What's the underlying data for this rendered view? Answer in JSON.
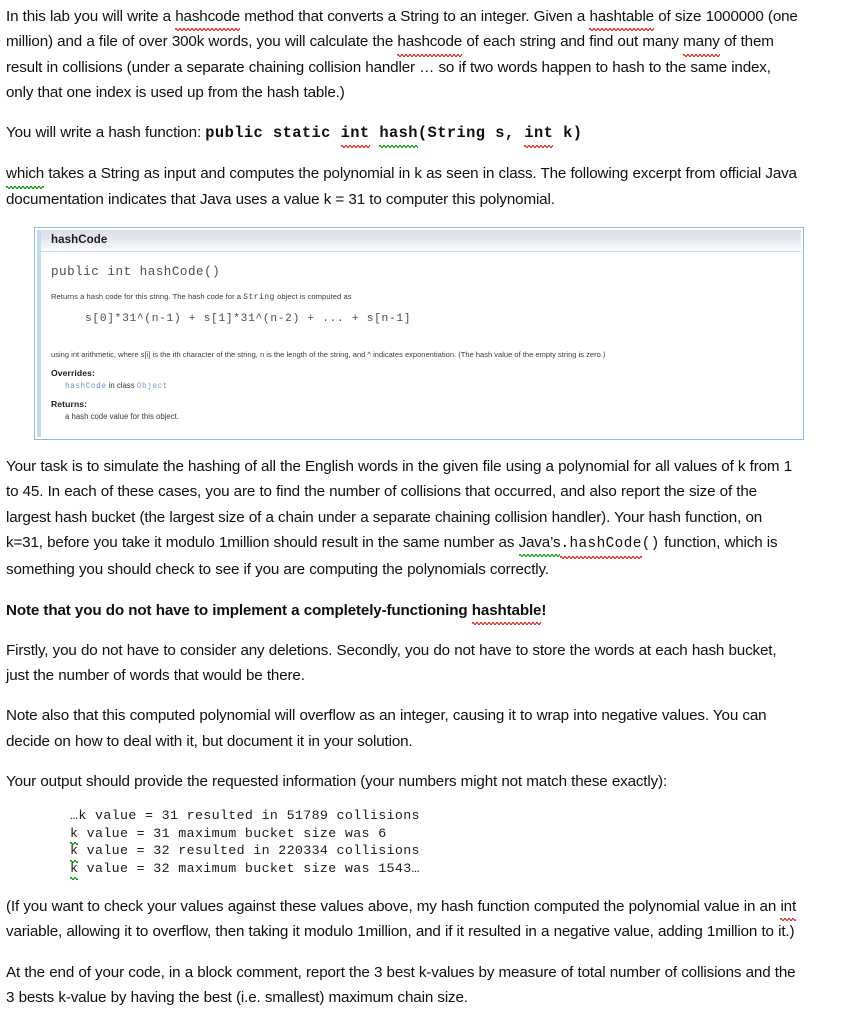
{
  "document": {
    "paragraphs": {
      "intro": {
        "part1": "In this lab you will write a ",
        "kw_hashcode": "hashcode",
        "part2": " method that converts a String to an integer. Given a ",
        "kw_hashtable": "hashtable",
        "part3": " of size 1000000 (one million) and a file of over 300k words, you will calculate the ",
        "kw_hashcode2": "hashcode",
        "part4": " of each string and find out many ",
        "kw_many": "many",
        "part5": " of them result in collisions (under a separate chaining collision handler … so if two words happen to hash to the same index, only that one index is used up from the hash table.)"
      },
      "signature_line": {
        "lead": "You will write a hash function: ",
        "code_a": "public static ",
        "code_int1": "int",
        "code_space": " ",
        "code_hash": "hash",
        "code_b": "(String s, ",
        "code_int2": "int",
        "code_c": " k)"
      },
      "which_takes": {
        "kw_which": "which",
        "rest": " takes a String as input and computes the polynomial in k as seen in class. The following excerpt from official Java documentation indicates that Java uses a value k = 31 to computer this polynomial."
      },
      "task": {
        "part1": "Your task is to simulate the hashing of all the English words in the given file using a polynomial for all values of k from 1 to 45. In each of these cases, you are to find the number of collisions that occurred, and also report the size of the largest hash bucket (the largest size of a chain under a separate chaining collision handler). Your hash function, on k=31, before you take it modulo 1million should result in the same number as ",
        "kw_javas": "Java’s",
        "kw_hashcode_call": " .hashCode",
        "code_parens": "()",
        "part2": " function, which is something you should check to see if you are computing the polynomials correctly."
      },
      "note_bold": {
        "text1": "Note that you do not have to implement a completely-functioning ",
        "kw_hashtable": "hashtable",
        "text2": "!"
      },
      "firstly": "Firstly, you do not have to consider any deletions. Secondly, you do not have to store the words at each hash bucket, just the number of words that would be there.",
      "overflow": "Note also that this computed polynomial will overflow as an integer, causing it to wrap into negative values. You can decide on how to deal with it, but document it in your solution.",
      "output_intro": "Your output should provide the requested information (your numbers might not match these exactly):",
      "check_values": {
        "part1": "(If you want to check your values against these values above, my hash function computed the polynomial value in an ",
        "kw_int": "int",
        "part2": " variable, allowing it to overflow, then taking it modulo 1million, and if it resulted in a negative value, adding 1million to it.)"
      },
      "block_comment": "At the end of your code, in a block comment, report the 3 best k-values by measure of total number of collisions and the 3 bests k-value by having the best (i.e. smallest) maximum chain size."
    },
    "javadoc_box": {
      "header": "hashCode",
      "signature": "public int hashCode()",
      "description_pre": "Returns a hash code for this string. The hash code for a ",
      "description_code": "String",
      "description_post": " object is computed as",
      "formula": "s[0]*31^(n-1) + s[1]*31^(n-2) + ... + s[n-1]",
      "note_pre": "using ",
      "note_code": "int",
      "note_mid": " arithmetic, where ",
      "note_code2": "s[i]",
      "note_post": " is the ith character of the string, n is the length of the string, and ^ indicates exponentiation. (The hash value of the empty string is zero.)",
      "overrides_label": "Overrides:",
      "overrides_link": "hashCode",
      "overrides_in_class": " in class ",
      "overrides_class": "Object",
      "returns_label": "Returns:",
      "returns_value": "a hash code value for this object."
    },
    "console_output": {
      "line1_prefix": "…k",
      "line1_rest": " value = 31 resulted in 51789 collisions",
      "line2_prefix": "k",
      "line2_rest": " value = 31 maximum bucket size was 6",
      "line3_prefix": "k",
      "line3_rest": " value = 32 resulted in 220334 collisions",
      "line4_prefix": "k",
      "line4_rest": " value = 32 maximum bucket size was 1543…"
    }
  },
  "colors": {
    "spell_error": "#e8302a",
    "grammar_error": "#16a016",
    "box_border": "#8fbcdb",
    "box_accent": "#c4dcef",
    "link": "#6b93c4"
  }
}
